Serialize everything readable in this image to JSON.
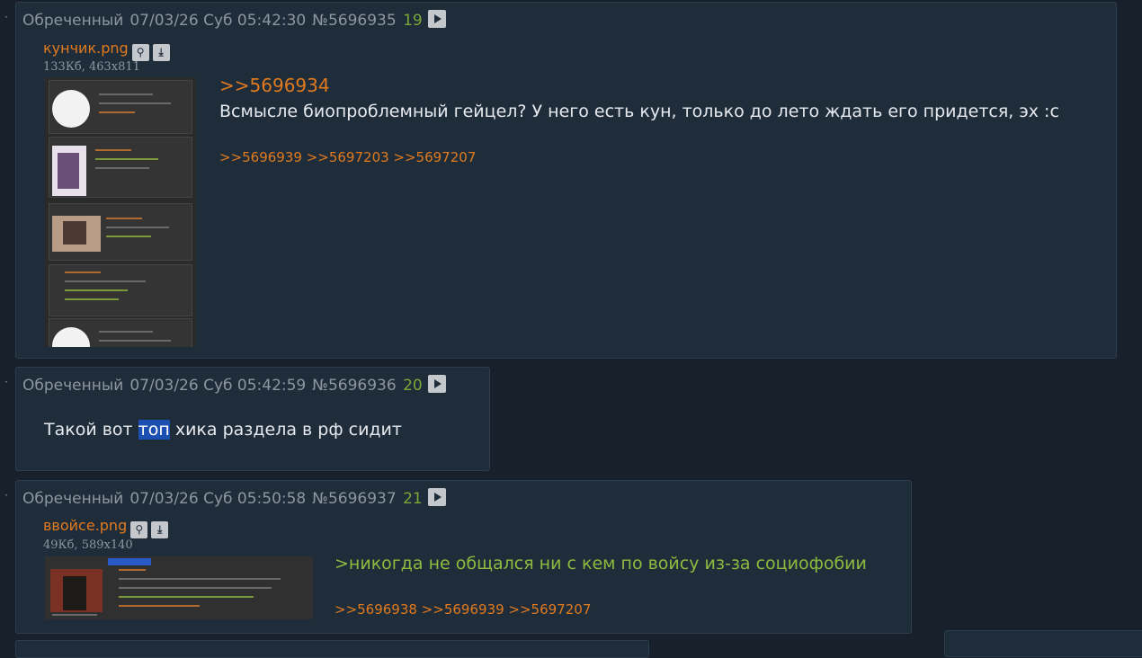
{
  "posts": [
    {
      "author": "Обреченный",
      "date": "07/03/26 Суб 05:42:30",
      "number": "№5696935",
      "index": "19",
      "file": {
        "name": "кунчик.png",
        "meta": "133Кб, 463x811"
      },
      "reply_to": ">>5696934",
      "text": "Всмысле биопроблемный гейцел? У него есть кун, только до лето ждать его придется, эх :с",
      "replies": ">>5696939 >>5697203 >>5697207"
    },
    {
      "author": "Обреченный",
      "date": "07/03/26 Суб 05:42:59",
      "number": "№5696936",
      "index": "20",
      "text_before": "Такой вот ",
      "text_highlight": "топ",
      "text_after": " хика раздела в рф сидит"
    },
    {
      "author": "Обреченный",
      "date": "07/03/26 Суб 05:50:58",
      "number": "№5696937",
      "index": "21",
      "file": {
        "name": "ввойсе.png",
        "meta": "49Кб, 589x140"
      },
      "quote": ">никогда не общался ни с кем по войсу из-за социофобии",
      "replies": ">>5696938 >>5696939 >>5697207"
    }
  ],
  "icons": {
    "play": "play-icon",
    "search": "magnifier-icon",
    "download": "download-icon"
  },
  "colors": {
    "background": "#17202b",
    "post_background": "#1f2c3a",
    "link": "#e07a1f",
    "quote": "#8dbb3e",
    "post_index": "#7ba638",
    "highlight": "#1c4fb2"
  }
}
